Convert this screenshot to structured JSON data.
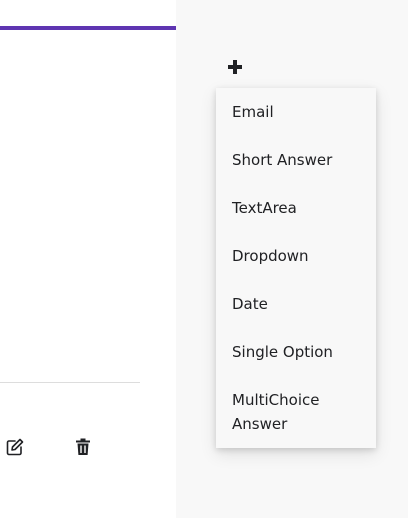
{
  "icons": {
    "add": "plus-icon",
    "edit": "edit-icon",
    "delete": "trash-icon"
  },
  "colors": {
    "accent": "#5e35b1",
    "menu_background": "#f8f8f8",
    "page_background": "#f8f8f8"
  },
  "menu": {
    "items": [
      {
        "label": "Email"
      },
      {
        "label": "Short Answer"
      },
      {
        "label": "TextArea"
      },
      {
        "label": "Dropdown"
      },
      {
        "label": "Date"
      },
      {
        "label": "Single Option"
      },
      {
        "label": "MultiChoice Answer"
      }
    ]
  }
}
